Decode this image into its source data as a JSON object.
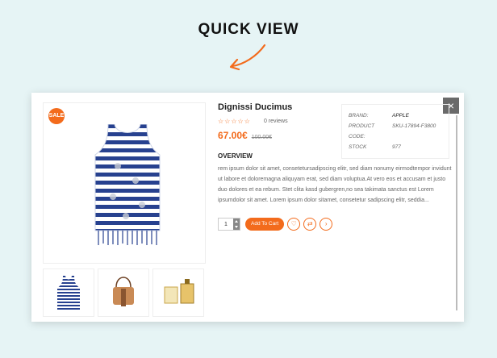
{
  "headline": "QUICK VIEW",
  "colors": {
    "accent": "#f36b1c",
    "background": "#e6f4f5"
  },
  "modal": {
    "close_icon": "×",
    "badge": "SALE",
    "product": {
      "title": "Dignissi Ducimus",
      "stars": "☆☆☆☆☆",
      "reviews": "0 reviews",
      "price": "67.00€",
      "old_price": "100.00€",
      "overview_title": "OVERVIEW",
      "description": "rem ipsum dolor sit amet, consetetursadipscing elitr, sed diam nonumy eirmodtempor invidunt ut labore et doloremagna aliquyam erat, sed diam voluptua.At vero eos et accusam et justo duo dolores et ea rebum. Stet clita kasd gubergren,no sea takimata sanctus est Lorem ipsumdolor sit amet. Lorem ipsum dolor sitamet, consetetur sadipscing elitr, seddia..."
    },
    "meta": {
      "brand_label": "BRAND:",
      "brand_value": "APPLE",
      "code_label": "PRODUCT CODE:",
      "code_value": "SKU-17894-F3800",
      "stock_label": "STOCK",
      "stock_value": "977"
    },
    "cart": {
      "quantity": "1",
      "add_label": "Add To Cart",
      "wishlist_icon": "♡",
      "compare_icon": "⇄",
      "next_icon": "›"
    },
    "thumbnails": [
      "tank-top-thumbnail",
      "handbag-thumbnail",
      "perfume-thumbnail"
    ]
  }
}
